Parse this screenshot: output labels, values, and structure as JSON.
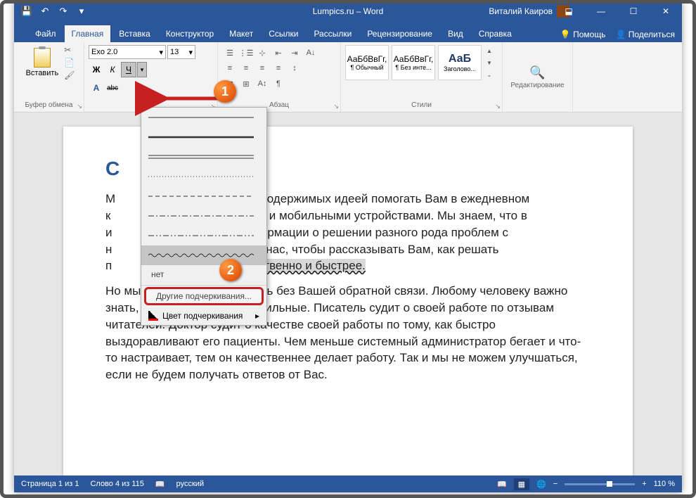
{
  "app": {
    "title": "Lumpics.ru – Word",
    "user": "Виталий Каиров"
  },
  "qat": {
    "save": "💾",
    "undo": "↶",
    "redo": "↷",
    "dd": "▾"
  },
  "winctl": {
    "ribbon": "⬓",
    "min": "—",
    "max": "☐",
    "close": "✕"
  },
  "tabs": {
    "file": "Файл",
    "home": "Главная",
    "insert": "Вставка",
    "design": "Конструктор",
    "layout": "Макет",
    "references": "Ссылки",
    "mailings": "Рассылки",
    "review": "Рецензирование",
    "view": "Вид",
    "help": "Справка",
    "tell": "Помощь",
    "share": "Поделиться"
  },
  "ribbon_groups": {
    "clipboard": {
      "label": "Буфер обмена",
      "paste": "Вставить"
    },
    "font": {
      "name": "Exo 2.0",
      "size": "13",
      "bold": "Ж",
      "italic": "К",
      "underline": "Ч",
      "dd": "▾",
      "A_style": "A",
      "abc": "abc"
    },
    "paragraph": {
      "label": "Абзац"
    },
    "styles": {
      "label": "Стили",
      "sample": "АаБбВвГг,",
      "sample_big": "АаБ",
      "normal": "¶ Обычный",
      "nospace": "¶ Без инте...",
      "heading": "Заголово..."
    },
    "editing": {
      "label": "Редактирование"
    }
  },
  "dropdown": {
    "none": "нет",
    "other": "Другие подчеркивания...",
    "color": "Цвет подчеркивания",
    "arrow": "▸"
  },
  "doc": {
    "heading": "С",
    "p1a": "М",
    "p1b": "тов, одержимых идеей помогать Вам в ежедневном",
    "p2a": "к",
    "p2b": "ами и мобильными устройствами. Мы знаем, что в",
    "p3a": "и",
    "p3b": "нформации о решении разного рода проблем с",
    "p4a": "н",
    "p4b": "ает нас, чтобы рассказывать Вам, как решать",
    "p5a": "п",
    "p5u": "более качественно и быстрее.",
    "p6": "Но мы не сможем это сделать без Вашей обратной связи. Любому человеку важно знать, что его действия правильные. Писатель судит о своей работе по отзывам читателей. Доктор судит о качестве своей работы по тому, как быстро выздоравливают его пациенты. Чем меньше системный администратор бегает и что-то настраивает, тем он качественнее делает работу. Так и мы не можем улучшаться, если не будем получать ответов от Вас."
  },
  "status": {
    "page": "Страница 1 из 1",
    "words": "Слово 4 из 115",
    "lang": "русский",
    "zoom": "110 %",
    "minus": "−",
    "plus": "+"
  },
  "annot": {
    "one": "1",
    "two": "2"
  }
}
